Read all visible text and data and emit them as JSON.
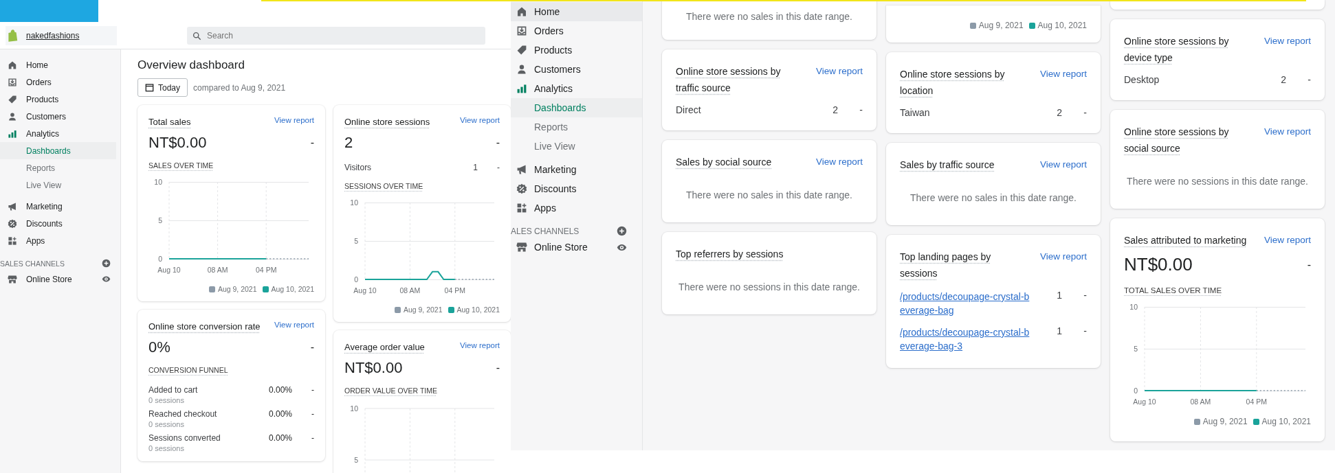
{
  "screen_a": {
    "top_bar": {
      "store_name": "nakedfashions",
      "search": {
        "placeholder": "Search"
      }
    },
    "sidebar": {
      "items": [
        {
          "label": "Home",
          "selected": false
        },
        {
          "label": "Orders",
          "selected": false
        },
        {
          "label": "Products",
          "selected": false
        },
        {
          "label": "Customers",
          "selected": false
        },
        {
          "label": "Analytics",
          "selected": false,
          "children": [
            {
              "label": "Dashboards",
              "selected": true
            },
            {
              "label": "Reports",
              "selected": false
            },
            {
              "label": "Live View",
              "selected": false
            }
          ]
        },
        {
          "label": "Marketing",
          "selected": false
        },
        {
          "label": "Discounts",
          "selected": false
        },
        {
          "label": "Apps",
          "selected": false
        }
      ],
      "sales_channels": {
        "heading": "SALES CHANNELS",
        "items": [
          {
            "label": "Online Store"
          }
        ]
      }
    },
    "page_title": "Overview dashboard",
    "date_button": "Today",
    "comparison": "compared to Aug 9, 2021",
    "columns": [
      [
        {
          "kind": "metric",
          "title": "Total sales",
          "view_report": "View report",
          "value": "NT$0.00",
          "trend": "-",
          "chart_data": {
            "type": "line",
            "grid": true,
            "title": "SALES OVER TIME",
            "categories": [
              "Aug 10",
              null,
              null,
              null,
              null,
              null,
              null,
              null,
              "08 AM",
              null,
              null,
              null,
              null,
              null,
              null,
              null,
              "04 PM",
              null,
              null,
              null,
              null,
              null,
              null,
              null
            ],
            "ylim": [
              0,
              10
            ],
            "yticks": [
              0,
              5,
              10
            ],
            "series": [
              {
                "name": "Aug 9, 2021",
                "color": "#8c9aa8",
                "line_style": "dashed",
                "values": [
                  null,
                  null,
                  null,
                  null,
                  null,
                  null,
                  null,
                  null,
                  null,
                  null,
                  null,
                  null,
                  null,
                  null,
                  null,
                  null,
                  0,
                  0,
                  0,
                  0,
                  0,
                  0,
                  0,
                  0
                ]
              },
              {
                "name": "Aug 10, 2021",
                "color": "#1aa39a",
                "line_style": "solid",
                "values": [
                  0,
                  0,
                  0,
                  0,
                  0,
                  0,
                  0,
                  0,
                  0,
                  0,
                  0,
                  0,
                  0,
                  0,
                  0,
                  0,
                  0,
                  null,
                  null,
                  null,
                  null,
                  null,
                  null,
                  null
                ]
              }
            ]
          }
        },
        {
          "kind": "funnel",
          "title": "Online store conversion rate",
          "view_report": "View report",
          "value": "0%",
          "trend": "-",
          "section": "CONVERSION FUNNEL",
          "rows": [
            {
              "label": "Added to cart",
              "sub": "0 sessions",
              "percent": "0.00%",
              "trend": "-"
            },
            {
              "label": "Reached checkout",
              "sub": "0 sessions",
              "percent": "0.00%",
              "trend": "-"
            },
            {
              "label": "Sessions converted",
              "sub": "0 sessions",
              "percent": "0.00%",
              "trend": "-"
            }
          ]
        }
      ],
      [
        {
          "kind": "metric",
          "title": "Online store sessions",
          "view_report": "View report",
          "value": "2",
          "trend": "-",
          "rows": [
            {
              "label": "Visitors",
              "count": "1",
              "trend": "-"
            }
          ],
          "chart_data": {
            "type": "line",
            "grid": true,
            "title": "SESSIONS OVER TIME",
            "categories": [
              "Aug 10",
              null,
              null,
              null,
              null,
              null,
              null,
              null,
              "08 AM",
              null,
              null,
              null,
              null,
              null,
              null,
              null,
              "04 PM",
              null,
              null,
              null,
              null,
              null,
              null,
              null
            ],
            "ylim": [
              0,
              10
            ],
            "yticks": [
              0,
              5,
              10
            ],
            "series": [
              {
                "name": "Aug 9, 2021",
                "color": "#8c9aa8",
                "line_style": "dashed",
                "values": [
                  null,
                  null,
                  null,
                  null,
                  null,
                  null,
                  null,
                  null,
                  null,
                  null,
                  null,
                  null,
                  null,
                  null,
                  null,
                  null,
                  0,
                  0,
                  0,
                  0,
                  0,
                  0,
                  0,
                  0
                ]
              },
              {
                "name": "Aug 10, 2021",
                "color": "#1aa39a",
                "line_style": "solid",
                "values": [
                  0,
                  0,
                  0,
                  0,
                  0,
                  0,
                  0,
                  0,
                  0,
                  0,
                  0,
                  0,
                  1,
                  1,
                  0,
                  0,
                  0,
                  null,
                  null,
                  null,
                  null,
                  null,
                  null,
                  null
                ]
              }
            ]
          }
        },
        {
          "kind": "metric",
          "title": "Average order value",
          "view_report": "View report",
          "value": "NT$0.00",
          "trend": "-",
          "chart_label": "ORDER VALUE OVER TIME",
          "axis_labels": [
            "10",
            "5"
          ]
        }
      ]
    ]
  },
  "screen_b": {
    "sidebar": {
      "items": [
        {
          "label": "Home",
          "selected": false,
          "hovered": true
        },
        {
          "label": "Orders",
          "selected": false,
          "hovered": false
        },
        {
          "label": "Products",
          "selected": false,
          "hovered": false
        },
        {
          "label": "Customers",
          "selected": false,
          "hovered": false
        },
        {
          "label": "Analytics",
          "selected": false,
          "hovered": false,
          "children": [
            {
              "label": "Dashboards",
              "selected": true
            },
            {
              "label": "Reports",
              "selected": false
            },
            {
              "label": "Live View",
              "selected": false
            }
          ]
        },
        {
          "label": "Marketing",
          "selected": false,
          "hovered": false
        },
        {
          "label": "Discounts",
          "selected": false,
          "hovered": false
        },
        {
          "label": "Apps",
          "selected": false,
          "hovered": false
        }
      ],
      "sales_channels": {
        "heading": "ALES CHANNELS",
        "items": [
          {
            "label": "Online Store"
          }
        ]
      }
    },
    "columns": [
      [
        {
          "kind": "empty",
          "cut": true,
          "message": "There were no sales in this date range."
        },
        {
          "kind": "rows",
          "title": "Online store sessions by traffic source",
          "view_report": "View report",
          "rows": [
            {
              "label": "Direct",
              "count": "2",
              "trend": "-"
            }
          ]
        },
        {
          "kind": "empty",
          "title": "Sales by social source",
          "view_report": "View report",
          "message": "There were no sales in this date range."
        },
        {
          "kind": "empty",
          "title": "Top referrers by sessions",
          "message": "There were no sessions in this date range."
        }
      ],
      [
        {
          "kind": "legend",
          "cut": true,
          "legend": [
            {
              "name": "Aug 9, 2021",
              "color": "#8c9aa8"
            },
            {
              "name": "Aug 10, 2021",
              "color": "#1aa39a"
            }
          ]
        },
        {
          "kind": "rows",
          "title": "Online store sessions by location",
          "view_report": "View report",
          "rows": [
            {
              "label": "Taiwan",
              "count": "2",
              "trend": "-"
            }
          ]
        },
        {
          "kind": "empty",
          "title": "Sales by traffic source",
          "view_report": "View report",
          "message": "There were no sales in this date range."
        },
        {
          "kind": "links",
          "title": "Top landing pages by sessions",
          "view_report": "View report",
          "rows": [
            {
              "label": "/products/decoupage-crystal-beverage-bag",
              "count": "1",
              "trend": "-"
            },
            {
              "label": "/products/decoupage-crystal-beverage-bag-3",
              "count": "1",
              "trend": "-"
            }
          ]
        }
      ],
      [
        {
          "kind": "blank",
          "cut": true
        },
        {
          "kind": "rows",
          "title": "Online store sessions by device type",
          "view_report": "View report",
          "rows": [
            {
              "label": "Desktop",
              "count": "2",
              "trend": "-"
            }
          ]
        },
        {
          "kind": "empty",
          "title": "Online store sessions by social source",
          "view_report": "View report",
          "message": "There were no sessions in this date range."
        },
        {
          "kind": "metric",
          "title": "Sales attributed to marketing",
          "view_report": "View report",
          "value": "NT$0.00",
          "trend": "-",
          "chart_data": {
            "type": "line",
            "grid": true,
            "title": "TOTAL SALES OVER TIME",
            "categories": [
              "Aug 10",
              null,
              null,
              null,
              null,
              null,
              null,
              null,
              "08 AM",
              null,
              null,
              null,
              null,
              null,
              null,
              null,
              "04 PM",
              null,
              null,
              null,
              null,
              null,
              null,
              null
            ],
            "ylim": [
              0,
              10
            ],
            "yticks": [
              0,
              5,
              10
            ],
            "series": [
              {
                "name": "Aug 9, 2021",
                "color": "#8c9aa8",
                "line_style": "dashed",
                "values": [
                  null,
                  null,
                  null,
                  null,
                  null,
                  null,
                  null,
                  null,
                  null,
                  null,
                  null,
                  null,
                  null,
                  null,
                  null,
                  null,
                  0,
                  0,
                  0,
                  0,
                  0,
                  0,
                  0,
                  0
                ]
              },
              {
                "name": "Aug 10, 2021",
                "color": "#1aa39a",
                "line_style": "solid",
                "values": [
                  0,
                  0,
                  0,
                  0,
                  0,
                  0,
                  0,
                  0,
                  0,
                  0,
                  0,
                  0,
                  0,
                  0,
                  0,
                  0,
                  0,
                  null,
                  null,
                  null,
                  null,
                  null,
                  null,
                  null
                ]
              }
            ]
          }
        }
      ]
    ]
  }
}
